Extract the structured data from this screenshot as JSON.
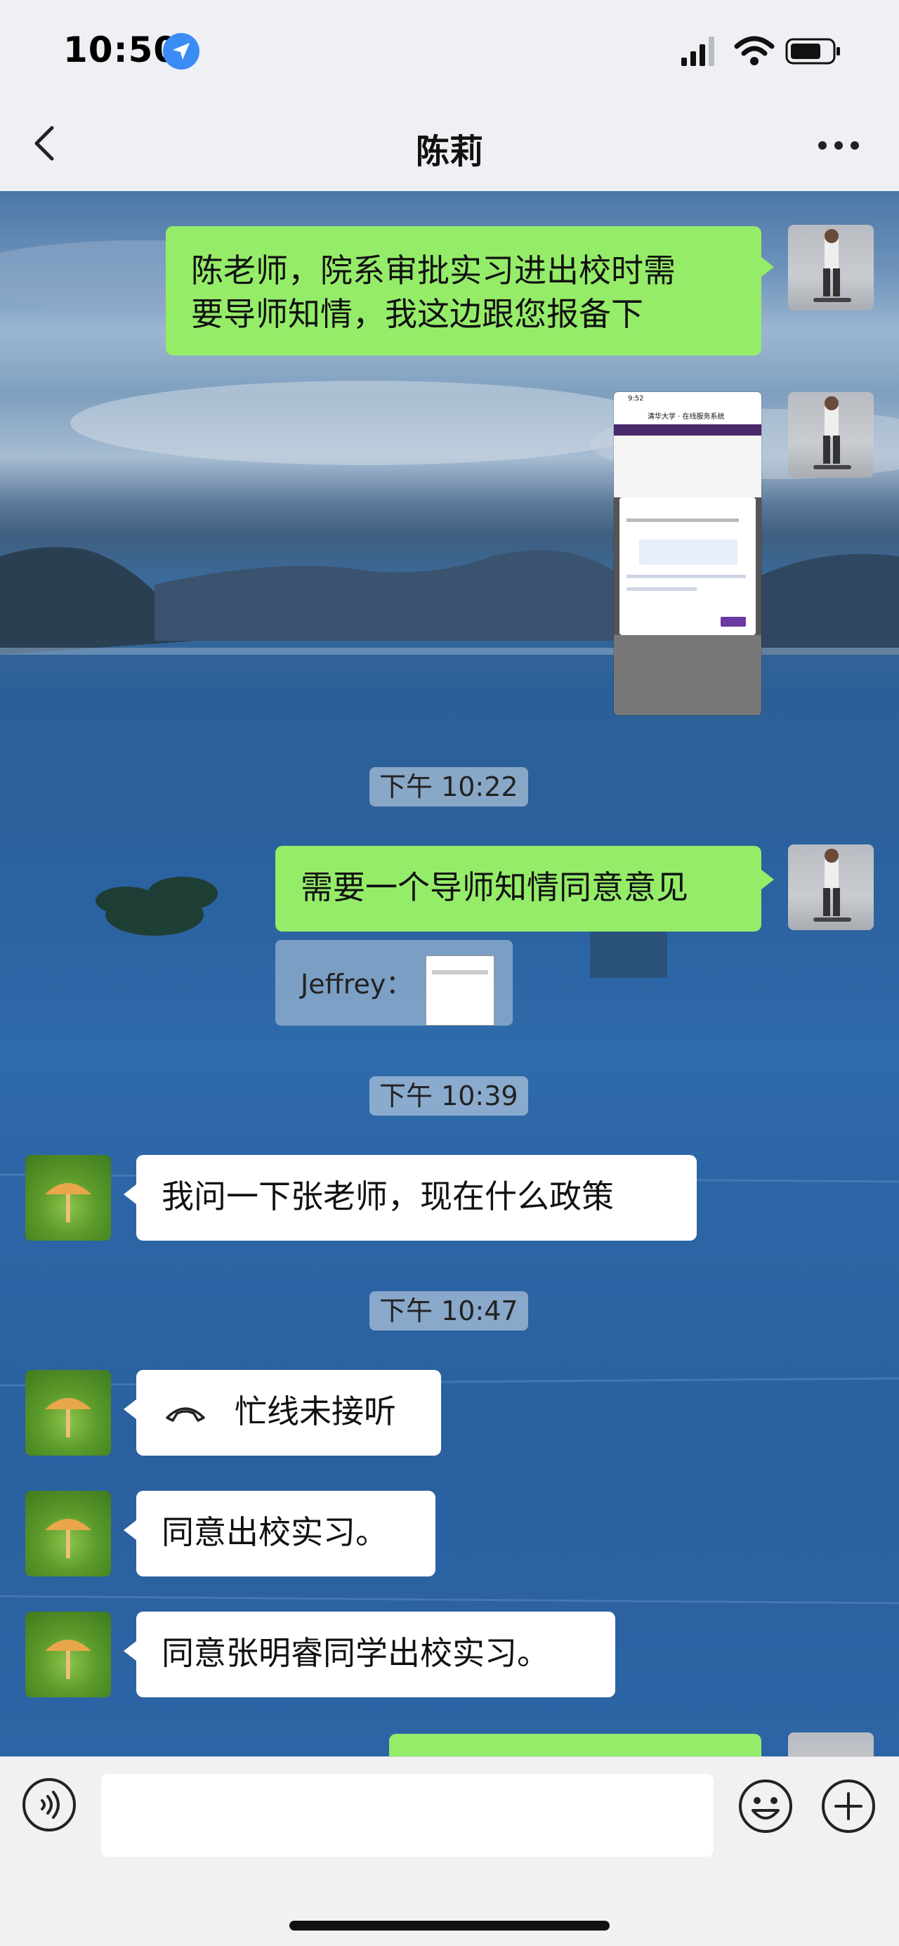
{
  "status_bar": {
    "time": "10:50"
  },
  "header": {
    "title": "陈莉"
  },
  "messages": {
    "m1": {
      "line1": "陈老师，院系审批实习进出校时需",
      "line2": "要导师知情，我这边跟您报备下"
    },
    "t1": "下午 10:22",
    "m2": "需要一个导师知情同意意见",
    "quote_author": "Jeffrey：",
    "t2": "下午 10:39",
    "m3": "我问一下张老师，现在什么政策",
    "t3": "下午 10:47",
    "m4": "忙线未接听",
    "m5": "同意出校实习。",
    "m6": "同意张明睿同学出校实习。"
  },
  "screenshot_thumb": {
    "time": "9:52",
    "app_title": "清华大学 · 在线服务系统"
  },
  "input": {
    "placeholder": ""
  },
  "icons": {
    "back": "chevron-left-icon",
    "more": "more-icon",
    "voice": "voice-icon",
    "emoji": "emoji-icon",
    "plus": "plus-icon",
    "call": "phone-hangup-icon"
  },
  "colors": {
    "my_bubble": "#95ec69",
    "their_bubble": "#ffffff",
    "location_badge": "#3a8cf4"
  }
}
